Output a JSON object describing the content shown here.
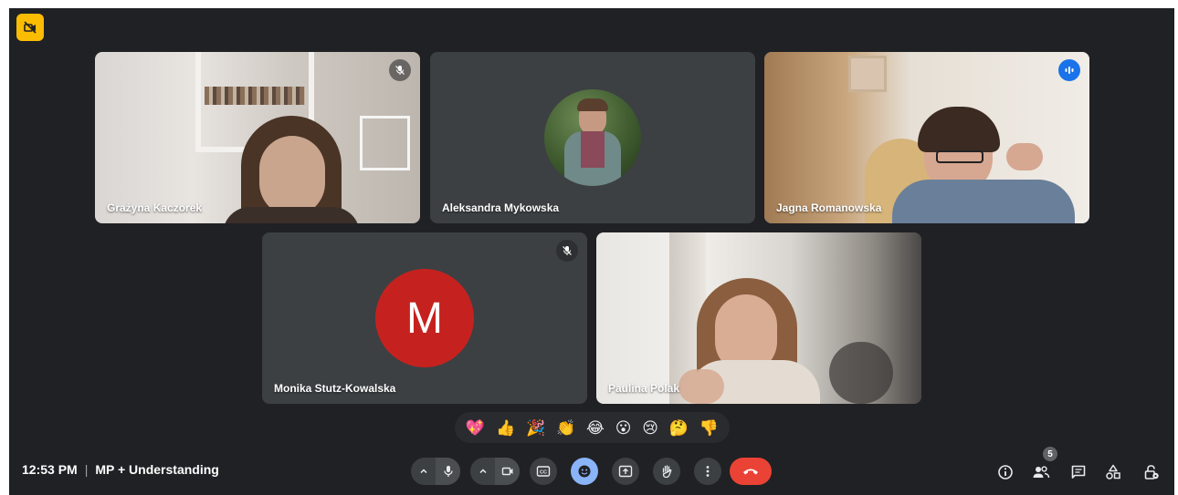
{
  "meeting": {
    "time": "12:53 PM",
    "separator": "|",
    "title": "MP + Understanding"
  },
  "participants": [
    {
      "name": "Grażyna Kaczorek",
      "muted": true,
      "video": true
    },
    {
      "name": "Aleksandra Mykowska",
      "muted": false,
      "video": false
    },
    {
      "name": "Jagna Romanowska",
      "muted": false,
      "video": true,
      "speaking": true
    },
    {
      "name": "Monika Stutz-Kowalska",
      "muted": true,
      "video": false,
      "initial": "M",
      "avatar_color": "#c5221f"
    },
    {
      "name": "Paulina Polak",
      "muted": false,
      "video": true
    }
  ],
  "reactions": [
    "💖",
    "👍",
    "🎉",
    "👏",
    "😂",
    "😮",
    "😢",
    "🤔",
    "👎"
  ],
  "controls": {
    "participant_count": "5"
  },
  "icons": {
    "top_left": "camera-off-icon",
    "mic": "mic-icon",
    "camera": "videocam-icon",
    "captions": "captions-icon",
    "emoji": "emoji-icon",
    "present": "present-screen-icon",
    "hand": "raise-hand-icon",
    "more": "more-vert-icon",
    "leave": "call-end-icon",
    "info": "info-icon",
    "people": "people-icon",
    "chat": "chat-icon",
    "activities": "activities-icon",
    "host": "host-controls-icon"
  },
  "colors": {
    "background": "#202124",
    "tile": "#3c4043",
    "active_outline": "#8ab4f8",
    "leave_button": "#ea4335",
    "emoji_button": "#8ab4f8",
    "top_badge": "#fbbc04"
  }
}
